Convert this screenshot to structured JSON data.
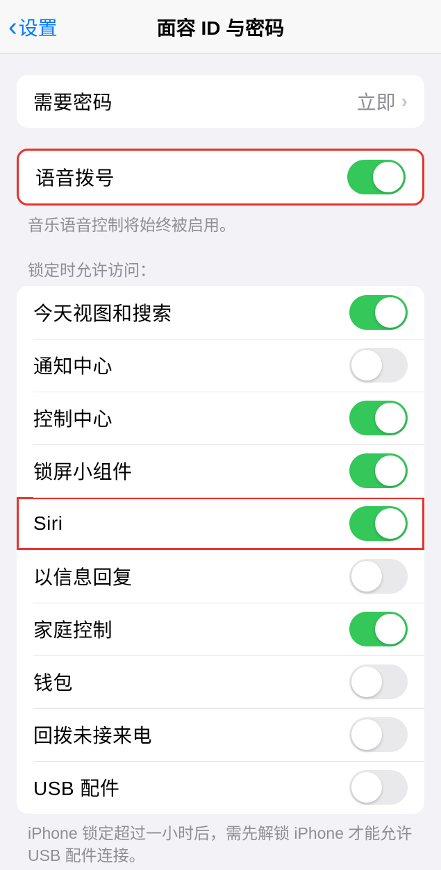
{
  "nav": {
    "back_label": "设置",
    "title": "面容 ID 与密码"
  },
  "require_passcode": {
    "label": "需要密码",
    "value": "立即"
  },
  "voice_dial": {
    "label": "语音拨号",
    "on": true,
    "footer": "音乐语音控制将始终被启用。"
  },
  "lock_access": {
    "header": "锁定时允许访问：",
    "items": [
      {
        "label": "今天视图和搜索",
        "on": true
      },
      {
        "label": "通知中心",
        "on": false
      },
      {
        "label": "控制中心",
        "on": true
      },
      {
        "label": "锁屏小组件",
        "on": true
      },
      {
        "label": "Siri",
        "on": true
      },
      {
        "label": "以信息回复",
        "on": false
      },
      {
        "label": "家庭控制",
        "on": true
      },
      {
        "label": "钱包",
        "on": false
      },
      {
        "label": "回拨未接来电",
        "on": false
      },
      {
        "label": "USB 配件",
        "on": false
      }
    ],
    "footer": "iPhone 锁定超过一小时后，需先解锁 iPhone 才能允许 USB 配件连接。"
  }
}
